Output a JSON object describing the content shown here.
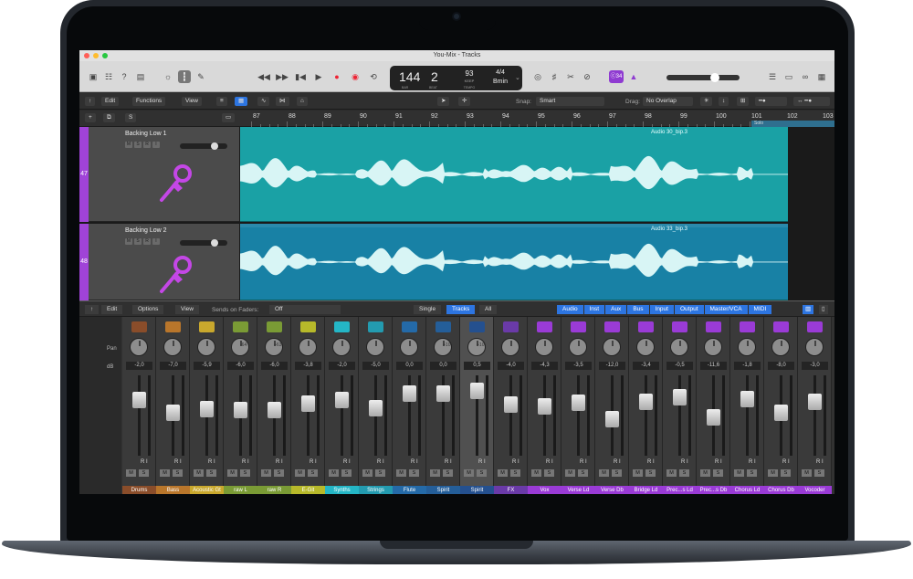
{
  "window": {
    "title": "You-Mix - Tracks"
  },
  "lcd": {
    "bar": "144",
    "beat": "2",
    "bar_label": "BAR",
    "beat_label": "BEAT",
    "tempo": "93",
    "tempo_sub": "KEEP",
    "tempo_label": "TEMPO",
    "sig": "4/4",
    "key": "Bmin"
  },
  "badge": "ⓒ34",
  "tracks_toolbar": {
    "edit": "Edit",
    "functions": "Functions",
    "view": "View",
    "snap_label": "Snap:",
    "snap_value": "Smart",
    "drag_label": "Drag:",
    "drag_value": "No Overlap"
  },
  "ruler": {
    "numbers": [
      "87",
      "88",
      "89",
      "90",
      "91",
      "92",
      "93",
      "94",
      "95",
      "96",
      "97",
      "98",
      "99",
      "100",
      "101",
      "102",
      "103"
    ],
    "solo": "Solo"
  },
  "tracks": [
    {
      "number": "47",
      "name": "Backing Low 1",
      "region": "Audio 30_bip.3"
    },
    {
      "number": "48",
      "name": "Backing Low 2",
      "region": "Audio 33_bip.3"
    }
  ],
  "track_buttons": [
    "M",
    "S",
    "R",
    "I"
  ],
  "mixer_toolbar": {
    "edit": "Edit",
    "options": "Options",
    "view": "View",
    "sends_label": "Sends on Faders:",
    "sends_value": "Off",
    "single": "Single",
    "tracks": "Tracks",
    "all": "All",
    "filters": [
      "Audio",
      "Inst",
      "Aux",
      "Bus",
      "Input",
      "Output",
      "Master/VCA",
      "MIDI"
    ]
  },
  "mixer_side": {
    "pan": "Pan",
    "db": "dB"
  },
  "channels": [
    {
      "name": "Drums",
      "db": "-2,0",
      "pan": "",
      "color": "#8a4d2a",
      "icon": "drum-icon"
    },
    {
      "name": "Bass",
      "db": "-7,0",
      "pan": "",
      "color": "#b9762b",
      "icon": "guitar-icon"
    },
    {
      "name": "Acoustic Gt",
      "db": "-5,9",
      "pan": "",
      "color": "#c9a82d",
      "icon": "guitar-icon"
    },
    {
      "name": "raw L",
      "db": "-6,0",
      "pan": "-64",
      "color": "#7a9b35",
      "icon": "wave-icon"
    },
    {
      "name": "raw R",
      "db": "-6,0",
      "pan": "+63",
      "color": "#7a9b35",
      "icon": "wave-icon"
    },
    {
      "name": "E-Git",
      "db": "-3,8",
      "pan": "",
      "color": "#b7b92a",
      "icon": "guitar-icon"
    },
    {
      "name": "Synths",
      "db": "-2,0",
      "pan": "",
      "color": "#24b6c6",
      "icon": "synth-icon"
    },
    {
      "name": "Strings",
      "db": "-5,0",
      "pan": "",
      "color": "#239bb0",
      "icon": "strings-icon"
    },
    {
      "name": "Flute",
      "db": "0,0",
      "pan": "",
      "color": "#246aa8",
      "icon": "flute-icon"
    },
    {
      "name": "Spirit",
      "db": "0,0",
      "pan": "+10",
      "color": "#245e99",
      "icon": "line-icon"
    },
    {
      "name": "Spirit",
      "db": "0,5",
      "pan": "+10",
      "color": "#24508f",
      "icon": "line-icon"
    },
    {
      "name": "FX",
      "db": "-4,0",
      "pan": "",
      "color": "#6a3aa8",
      "icon": "fx-icon"
    },
    {
      "name": "Vox",
      "db": "-4,3",
      "pan": "",
      "color": "#9a3bd6",
      "icon": "mic-icon"
    },
    {
      "name": "Verse Ld",
      "db": "-3,5",
      "pan": "",
      "color": "#9a3bd6",
      "icon": "mic-icon"
    },
    {
      "name": "Verse Db",
      "db": "-12,0",
      "pan": "",
      "color": "#9a3bd6",
      "icon": "mic-icon"
    },
    {
      "name": "Bridge Ld",
      "db": "-3,4",
      "pan": "",
      "color": "#9a3bd6",
      "icon": "mic-icon"
    },
    {
      "name": "Prec...s Ld",
      "db": "-0,5",
      "pan": "",
      "color": "#9a3bd6",
      "icon": "mic-icon"
    },
    {
      "name": "Prec...s Db",
      "db": "-11,6",
      "pan": "",
      "color": "#9a3bd6",
      "icon": "mic-icon"
    },
    {
      "name": "Chorus Ld",
      "db": "-1,8",
      "pan": "",
      "color": "#9a3bd6",
      "icon": "mic-icon"
    },
    {
      "name": "Chorus Db",
      "db": "-8,0",
      "pan": "",
      "color": "#9a3bd6",
      "icon": "mic-icon"
    },
    {
      "name": "Vocoder",
      "db": "-3,0",
      "pan": "",
      "color": "#9a3bd6",
      "icon": "mic-icon"
    }
  ],
  "ri_label": "R I",
  "colors": {
    "track_purple": "#a043d8",
    "region1": "#1aa1a5",
    "region2": "#1881a5",
    "blue_button": "#2d75e1"
  }
}
